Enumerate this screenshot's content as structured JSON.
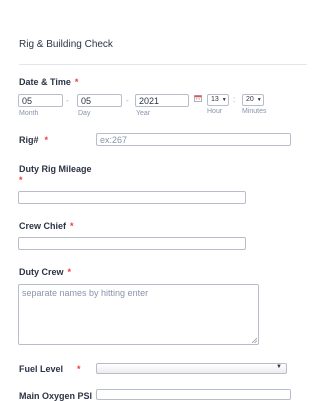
{
  "form": {
    "title": "Rig & Building Check"
  },
  "date_time": {
    "label": "Date & Time",
    "required_mark": "*",
    "month_value": "05",
    "month_label": "Month",
    "day_value": "05",
    "day_label": "Day",
    "year_value": "2021",
    "year_label": "Year",
    "separator": "-",
    "hour_value": "13",
    "hour_label": "Hour",
    "minutes_value": "20",
    "minutes_label": "Minutes",
    "time_separator": ":"
  },
  "rig": {
    "label": "Rig#",
    "required_mark": "*",
    "placeholder": "ex:267"
  },
  "duty_rig_mileage": {
    "label": "Duty Rig Mileage",
    "required_mark": "*",
    "value": ""
  },
  "crew_chief": {
    "label": "Crew Chief",
    "required_mark": "*",
    "value": ""
  },
  "duty_crew": {
    "label": "Duty Crew",
    "required_mark": "*",
    "placeholder": "separate names by hitting enter"
  },
  "fuel_level": {
    "label": "Fuel Level",
    "required_mark": "*",
    "value": ""
  },
  "main_oxygen": {
    "label": "Main Oxygen PSI",
    "value": ""
  },
  "icons": {
    "calendar": "calendar-icon",
    "dropdown": "chevron-down-icon"
  },
  "colors": {
    "required": "#f23a3c",
    "text": "#2c3345",
    "sublabel": "#8894ab",
    "border": "#b8bdc9"
  }
}
